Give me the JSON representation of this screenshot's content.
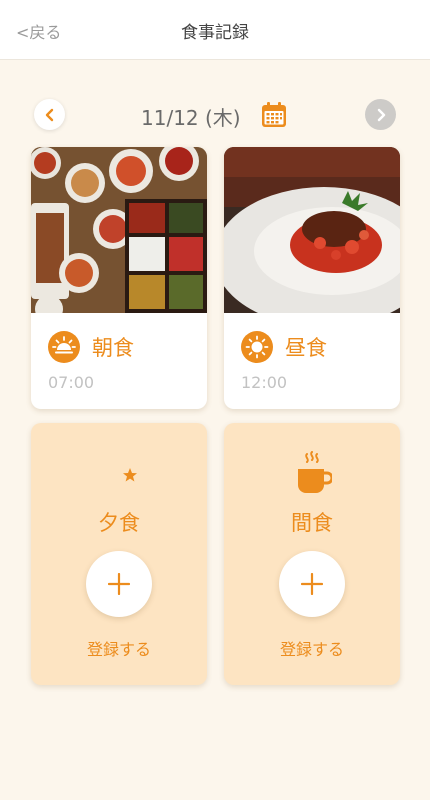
{
  "header": {
    "back_label": "<戻る",
    "title": "食事記録"
  },
  "date_nav": {
    "date": "11/12 (木)",
    "prev_icon": "chevron-left-icon",
    "next_icon": "chevron-right-icon",
    "calendar_icon": "calendar-icon"
  },
  "colors": {
    "accent": "#ec8c1d",
    "background": "#fcf6ec",
    "empty_card": "#fde4c2",
    "muted_text": "#c2c2c2"
  },
  "meals": [
    {
      "label": "朝食",
      "time": "07:00",
      "icon": "sunrise-icon",
      "photo": "korean-breakfast-photo"
    },
    {
      "label": "昼食",
      "time": "12:00",
      "icon": "sun-icon",
      "photo": "meat-in-tomato-sauce-photo"
    },
    {
      "label": "夕食",
      "icon": "moon-star-icon",
      "action": "登録する"
    },
    {
      "label": "間食",
      "icon": "coffee-cup-icon",
      "action": "登録する"
    }
  ]
}
